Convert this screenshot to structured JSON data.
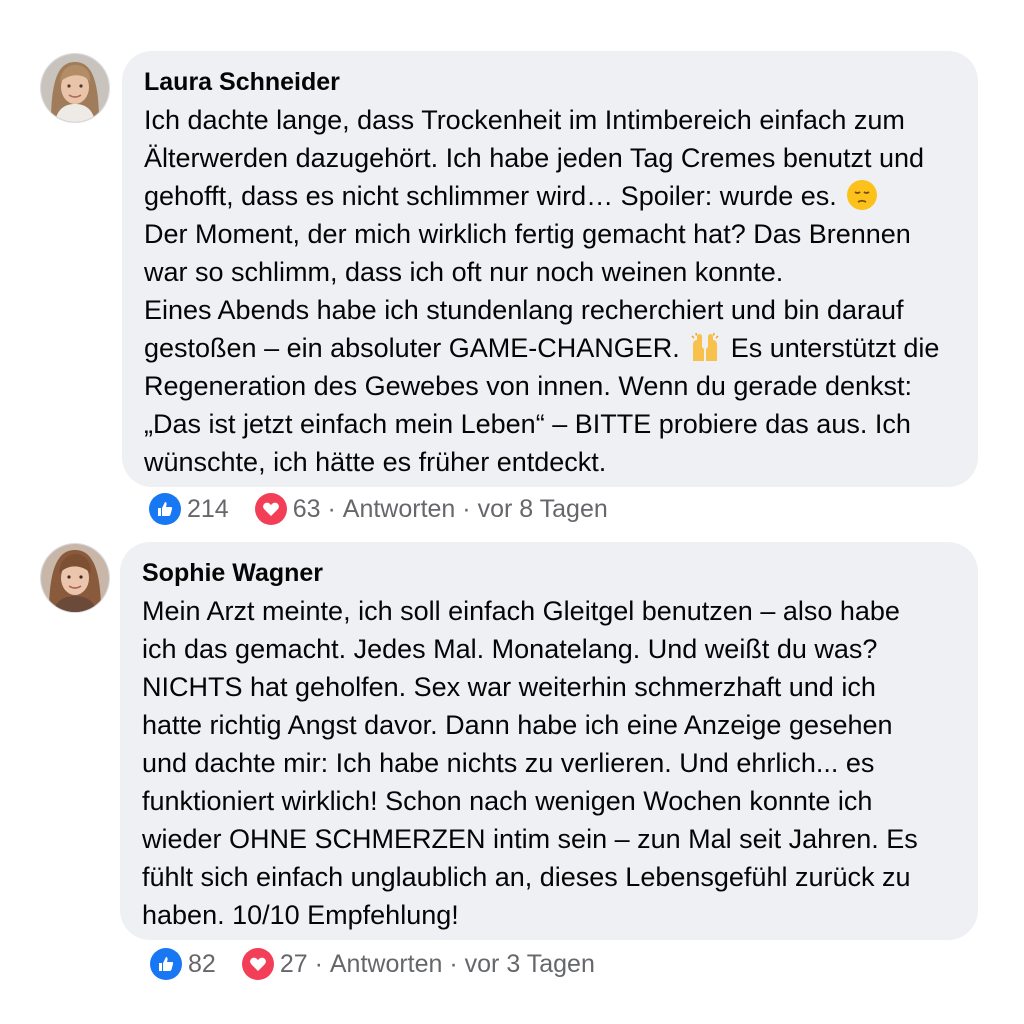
{
  "comments": [
    {
      "author": "Laura Schneider",
      "lines": [
        "Ich dachte lange, dass Trockenheit im Intimbereich einfach zum",
        "Älterwerden dazugehört. Ich habe jeden Tag Cremes benutzt und",
        "gehofft, dass es nicht schlimmer wird… Spoiler: wurde es.",
        "Der Moment, der mich wirklich fertig gemacht hat? Das Brennen",
        "war so schlimm, dass ich oft nur noch weinen konnte.",
        "Eines Abends habe ich stundenlang recherchiert und bin darauf",
        "gestoßen – ein absoluter GAME-CHANGER.",
        "Es unterstützt die",
        "Regeneration des Gewebes von innen. Wenn du gerade denkst:",
        "„Das ist jetzt einfach mein Leben“ – BITTE probiere das aus. Ich",
        "wünschte, ich hätte es früher entdeckt."
      ],
      "emojis": [
        "pensive-face-emoji",
        "raising-hands-emoji"
      ],
      "likes": "214",
      "hearts": "63",
      "separator": "·",
      "reply_label": "Antworten",
      "time": "vor 8 Tagen"
    },
    {
      "author": "Sophie Wagner",
      "lines": [
        "Mein Arzt meinte, ich soll einfach Gleitgel benutzen – also habe",
        "ich das gemacht. Jedes Mal. Monatelang. Und weißt du was?",
        "NICHTS hat geholfen. Sex war weiterhin schmerzhaft und ich",
        "hatte richtig Angst davor. Dann habe ich eine Anzeige gesehen",
        "und dachte mir: Ich habe nichts zu verlieren. Und ehrlich... es",
        "funktioniert wirklich! Schon nach wenigen Wochen konnte ich",
        "wieder OHNE SCHMERZEN intim sein – zun Mal seit Jahren. Es",
        "fühlt sich einfach unglaublich an, dieses Lebensgefühl zurück zu",
        "haben. 10/10 Empfehlung!"
      ],
      "likes": "82",
      "hearts": "27",
      "separator": "·",
      "reply_label": "Antworten",
      "time": "vor 3 Tagen"
    }
  ],
  "colors": {
    "bubble": "#eef0f4",
    "like": "#1877f2",
    "heart": "#f33e58",
    "meta_text": "#65676b"
  },
  "icons": [
    "avatar-laura",
    "avatar-sophie",
    "like-icon",
    "heart-icon"
  ]
}
